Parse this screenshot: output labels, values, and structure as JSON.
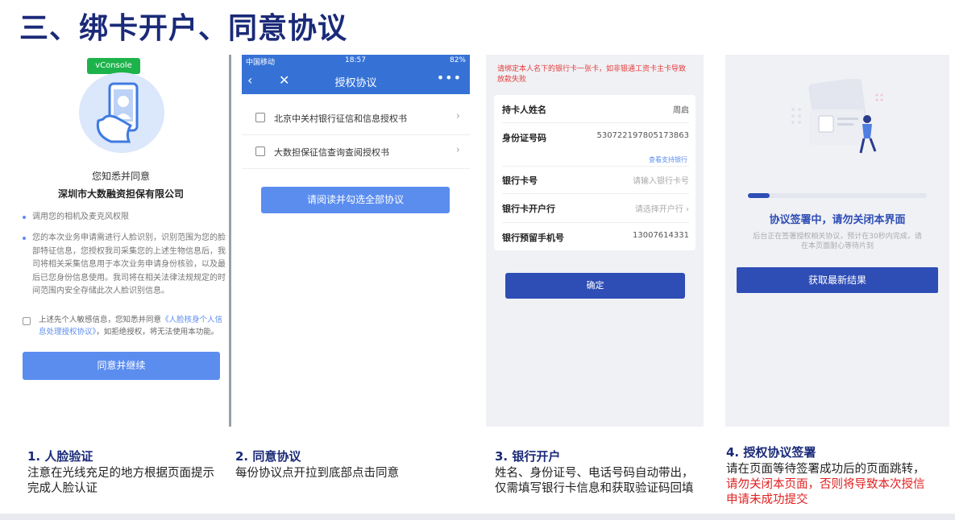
{
  "page_title": "三、绑卡开户、同意协议",
  "panel1": {
    "vconsole_label": "vConsole",
    "consent_title": "您知悉并同意",
    "company": "深圳市大数融资担保有限公司",
    "bullets": [
      "调用您的相机及麦克风权限",
      "您的本次业务申请需进行人脸识别，识别范围为您的脸部特征信息，您授权我司采集您的上述生物信息后，我司将相关采集信息用于本次业务申请身份核验，以及最后已您身份信息使用。我司将在相关法律法规规定的时间范围内安全存储此次人脸识别信息。"
    ],
    "agree_prefix": "上述先个人敏感信息，您知悉并同意",
    "agree_link": "《人脸核身个人信息处理授权协议》",
    "agree_suffix": "，如拒绝授权，将无法使用本功能。",
    "button": "同意并继续"
  },
  "panel2": {
    "status_left": "中国移动",
    "status_time": "18:57",
    "status_battery": "82%",
    "nav_title": "授权协议",
    "nav_back": "‹",
    "nav_close": "✕",
    "nav_more": "•••",
    "items": [
      "北京中关村银行征信和信息授权书",
      "大数担保征信查询查阅授权书"
    ],
    "button": "请阅读并勾选全部协议"
  },
  "panel3": {
    "notice": "请绑定本人名下的银行卡一张卡，如非银通工资卡主卡导致放款失败",
    "rows": [
      {
        "label": "持卡人姓名",
        "value": "周启"
      },
      {
        "label": "身份证号码",
        "value": "530722197805173863"
      },
      {
        "label": "银行卡号",
        "value": "请输入银行卡号"
      },
      {
        "label": "银行卡开户行",
        "value": "请选择开户行"
      },
      {
        "label": "银行预留手机号",
        "value": "13007614331"
      }
    ],
    "support_link": "查看支持银行",
    "button": "确定"
  },
  "panel4": {
    "progress": 0.12,
    "title": "协议签署中，请勿关闭本界面",
    "desc": "后台正在签署授权相关协议，预计在30秒内完成，请在本页面耐心等待片刻",
    "button": "获取最新结果"
  },
  "steps": [
    {
      "title": "1. 人脸验证",
      "body": "注意在光线充足的地方根据页面提示完成人脸认证"
    },
    {
      "title": "2. 同意协议",
      "body": "每份协议点开拉到底部点击同意"
    },
    {
      "title": "3. 银行开户",
      "body": "姓名、身份证号、电话号码自动带出，仅需填写银行卡信息和获取验证码回填"
    },
    {
      "title": "4. 授权协议签署",
      "body": "请在页面等待签署成功后的页面跳转，",
      "warning": "请勿关闭本页面，否则将导致本次授信申请未成功提交"
    }
  ],
  "colors": {
    "title": "#1a2a78",
    "accent_light": "#5b8def",
    "accent_dark": "#2e4db5",
    "warning": "#e02020"
  }
}
